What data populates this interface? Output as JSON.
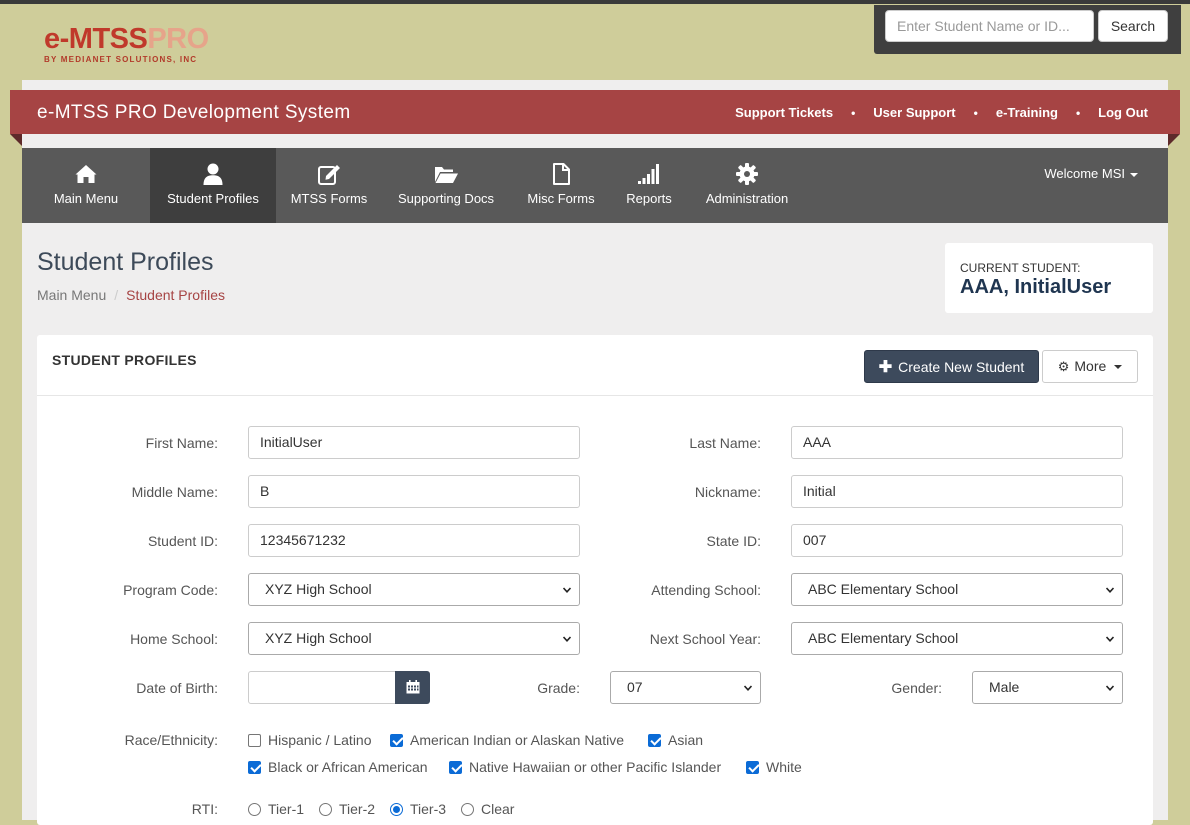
{
  "logo": {
    "part1": "e-MTSS",
    "part2": "PRO",
    "sub": "BY MEDIANET SOLUTIONS, INC"
  },
  "search": {
    "placeholder": "Enter Student Name or ID...",
    "button": "Search"
  },
  "banner": {
    "title": "e-MTSS PRO Development System",
    "links": [
      "Support Tickets",
      "User Support",
      "e-Training",
      "Log Out"
    ],
    "separator": "•"
  },
  "nav": {
    "items": [
      {
        "label": "Main Menu",
        "icon": "home-icon"
      },
      {
        "label": "Student Profiles",
        "icon": "user-icon"
      },
      {
        "label": "MTSS Forms",
        "icon": "edit-icon"
      },
      {
        "label": "Supporting Docs",
        "icon": "folder-open-icon"
      },
      {
        "label": "Misc Forms",
        "icon": "file-icon"
      },
      {
        "label": "Reports",
        "icon": "signal-bars-icon"
      },
      {
        "label": "Administration",
        "icon": "gear-icon"
      }
    ],
    "active": "Student Profiles",
    "welcome": "Welcome MSI"
  },
  "page": {
    "title": "Student Profiles",
    "breadcrumb": [
      "Main Menu",
      "Student Profiles"
    ],
    "breadcrumb_sep": "/"
  },
  "current_student": {
    "label": "CURRENT STUDENT:",
    "name": "AAA, InitialUser"
  },
  "panel": {
    "title": "STUDENT PROFILES",
    "create_button": "Create New Student",
    "more_button": "More"
  },
  "form": {
    "first_name": {
      "label": "First Name:",
      "value": "InitialUser"
    },
    "last_name": {
      "label": "Last Name:",
      "value": "AAA"
    },
    "middle_name": {
      "label": "Middle Name:",
      "value": "B"
    },
    "nickname": {
      "label": "Nickname:",
      "value": "Initial"
    },
    "student_id": {
      "label": "Student ID:",
      "value": "12345671232"
    },
    "state_id": {
      "label": "State ID:",
      "value": "007"
    },
    "program_code": {
      "label": "Program Code:",
      "value": "XYZ High School"
    },
    "attending_school": {
      "label": "Attending School:",
      "value": "ABC Elementary School"
    },
    "home_school": {
      "label": "Home School:",
      "value": "XYZ High School"
    },
    "next_school_year": {
      "label": "Next School Year:",
      "value": "ABC Elementary School"
    },
    "dob": {
      "label": "Date of Birth:",
      "value": ""
    },
    "grade": {
      "label": "Grade:",
      "value": "07"
    },
    "gender": {
      "label": "Gender:",
      "value": "Male"
    },
    "race": {
      "label": "Race/Ethnicity:",
      "options": [
        {
          "label": "Hispanic / Latino",
          "checked": false
        },
        {
          "label": "American Indian or Alaskan Native",
          "checked": true
        },
        {
          "label": "Asian",
          "checked": true
        },
        {
          "label": "Black or African American",
          "checked": true
        },
        {
          "label": "Native Hawaiian or other Pacific Islander",
          "checked": true
        },
        {
          "label": "White",
          "checked": true
        }
      ]
    },
    "rti": {
      "label": "RTI:",
      "options": [
        "Tier-1",
        "Tier-2",
        "Tier-3",
        "Clear"
      ],
      "selected": "Tier-3"
    }
  },
  "colors": {
    "banner": "#a64444",
    "nav": "#595959",
    "nav_active": "#3e3e3e",
    "primary_button": "#3d4a5c",
    "background": "#cfcd9a",
    "accent_link": "#a64444",
    "student_name": "#1f3550"
  }
}
